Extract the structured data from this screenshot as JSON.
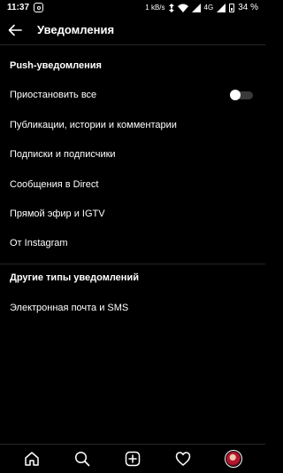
{
  "status_bar": {
    "time": "11:37",
    "network_speed": "1 kB/s",
    "network_type": "4G",
    "battery": "34 %"
  },
  "header": {
    "title": "Уведомления",
    "back_icon": "arrow-left-icon"
  },
  "sections": {
    "push": {
      "title": "Push-уведомления",
      "items": [
        "Приостановить все",
        "Публикации, истории и комментарии",
        "Подписки и подписчики",
        "Сообщения в Direct",
        "Прямой эфир и IGTV",
        "От Instagram"
      ],
      "pause_all_toggle": {
        "on": false
      }
    },
    "other": {
      "title": "Другие типы уведомлений",
      "items": [
        "Электронная почта и SMS"
      ]
    }
  },
  "bottom_nav": {
    "icons": [
      "home-icon",
      "search-icon",
      "add-post-icon",
      "heart-icon",
      "profile-avatar"
    ]
  },
  "colors": {
    "background": "#000000",
    "text": "#ffffff",
    "divider": "#262626",
    "toggle_track": "#3a3a3a"
  }
}
